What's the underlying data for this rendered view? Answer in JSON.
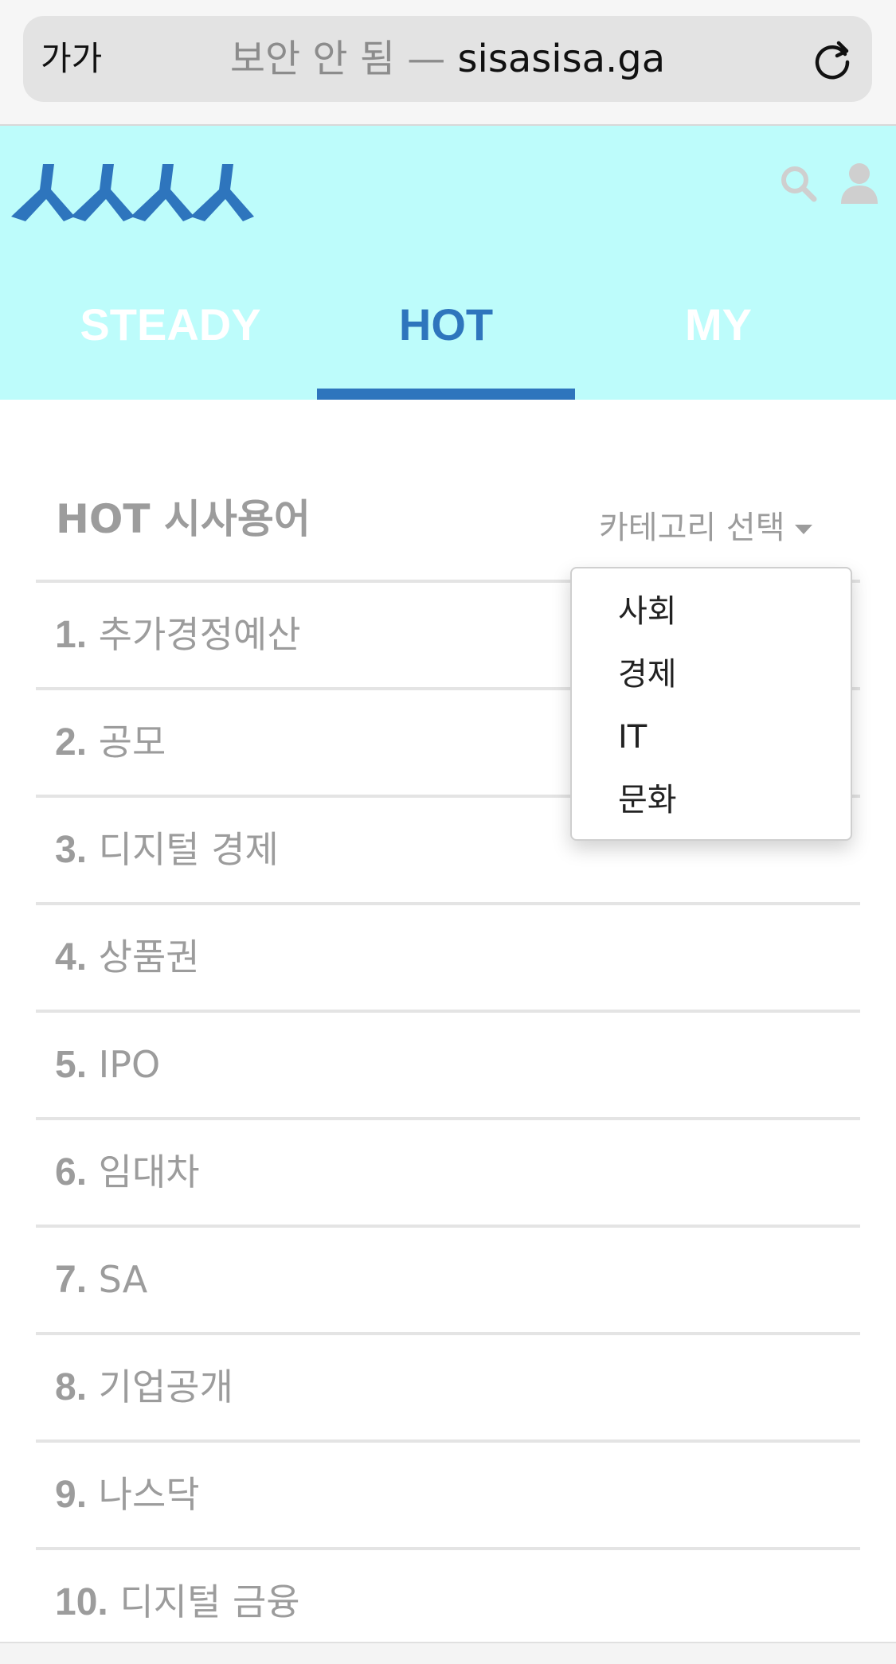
{
  "browser": {
    "text_size_label": "가가",
    "url_prefix": "보안 안 됨 — ",
    "url_domain": "sisasisa.ga",
    "reload_icon": "reload-icon"
  },
  "header": {
    "logo_text": "ㅅㅅㅅㅅ",
    "brand_color": "#2e75bd",
    "background_color": "#bdfcfb",
    "search_icon": "search-icon",
    "user_icon": "user-icon"
  },
  "tabs": [
    {
      "label": "STEADY",
      "active": false
    },
    {
      "label": "HOT",
      "active": true
    },
    {
      "label": "MY",
      "active": false
    }
  ],
  "content": {
    "section_title": "HOT 시사용어",
    "category_select_label": "카테고리 선택"
  },
  "dropdown": {
    "items": [
      "사회",
      "경제",
      "IT",
      "문화"
    ]
  },
  "terms": [
    {
      "num": "1.",
      "label": "추가경정예산"
    },
    {
      "num": "2.",
      "label": "공모"
    },
    {
      "num": "3.",
      "label": "디지털 경제"
    },
    {
      "num": "4.",
      "label": "상품권"
    },
    {
      "num": "5.",
      "label": "IPO"
    },
    {
      "num": "6.",
      "label": "임대차"
    },
    {
      "num": "7.",
      "label": "SA"
    },
    {
      "num": "8.",
      "label": "기업공개"
    },
    {
      "num": "9.",
      "label": "나스닥"
    },
    {
      "num": "10.",
      "label": "디지털 금융"
    }
  ]
}
